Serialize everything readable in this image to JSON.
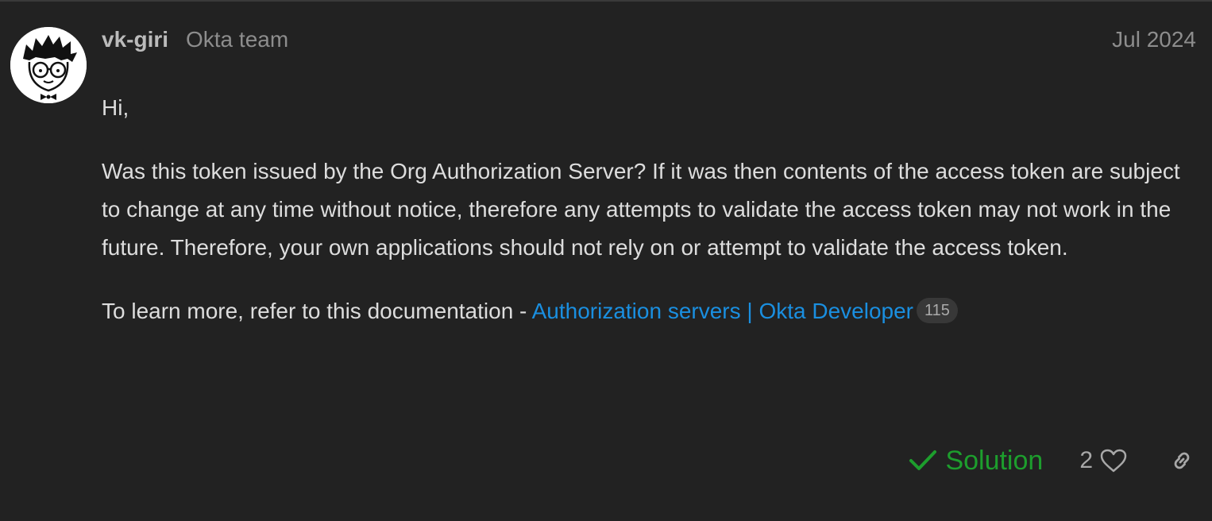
{
  "post": {
    "author": {
      "username": "vk-giri",
      "title": "Okta team",
      "avatar_icon": "cartoon-face-with-glasses-avatar"
    },
    "date": "Jul 2024",
    "body": {
      "greeting": "Hi,",
      "paragraph": "Was this token issued by the Org Authorization Server? If it was then contents of the access token are subject to change at any time without notice, therefore any attempts to validate the access token may not work in the future. Therefore, your own applications should not rely on or attempt to validate the access token.",
      "doc_intro": "To learn more, refer to this documentation - ",
      "doc_link_text": "Authorization servers | Okta Developer",
      "doc_link_clicks": "115"
    },
    "actions": {
      "solution_label": "Solution",
      "solution_icon": "check-icon",
      "like_count": "2",
      "like_icon": "heart-icon",
      "link_icon": "link-icon"
    }
  },
  "colors": {
    "background": "#222222",
    "text": "#dddddd",
    "muted": "#8d8d8d",
    "link": "#1a8fe0",
    "solution": "#1d9e2d"
  }
}
